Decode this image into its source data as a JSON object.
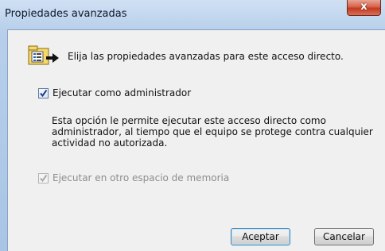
{
  "window": {
    "title": "Propiedades avanzadas",
    "close_glyph": "x"
  },
  "header": {
    "icon": "shortcut-properties-icon",
    "text": "Elija las propiedades avanzadas para este acceso directo."
  },
  "run_as_admin": {
    "label": "Ejecutar como administrador",
    "checked": true,
    "enabled": true
  },
  "description": "Esta opción le permite ejecutar este acceso directo como administrador, al tiempo que el equipo se protege contra cualquier actividad no autorizada.",
  "separate_memory": {
    "label": "Ejecutar en otro espacio de memoria",
    "checked": true,
    "enabled": false
  },
  "buttons": {
    "ok": "Aceptar",
    "cancel": "Cancelar"
  },
  "colors": {
    "titlebar": "#b7cfea",
    "close_button": "#c23a20",
    "dialog_bg": "#f0f0f0",
    "default_button_border": "#3c7fb1"
  }
}
